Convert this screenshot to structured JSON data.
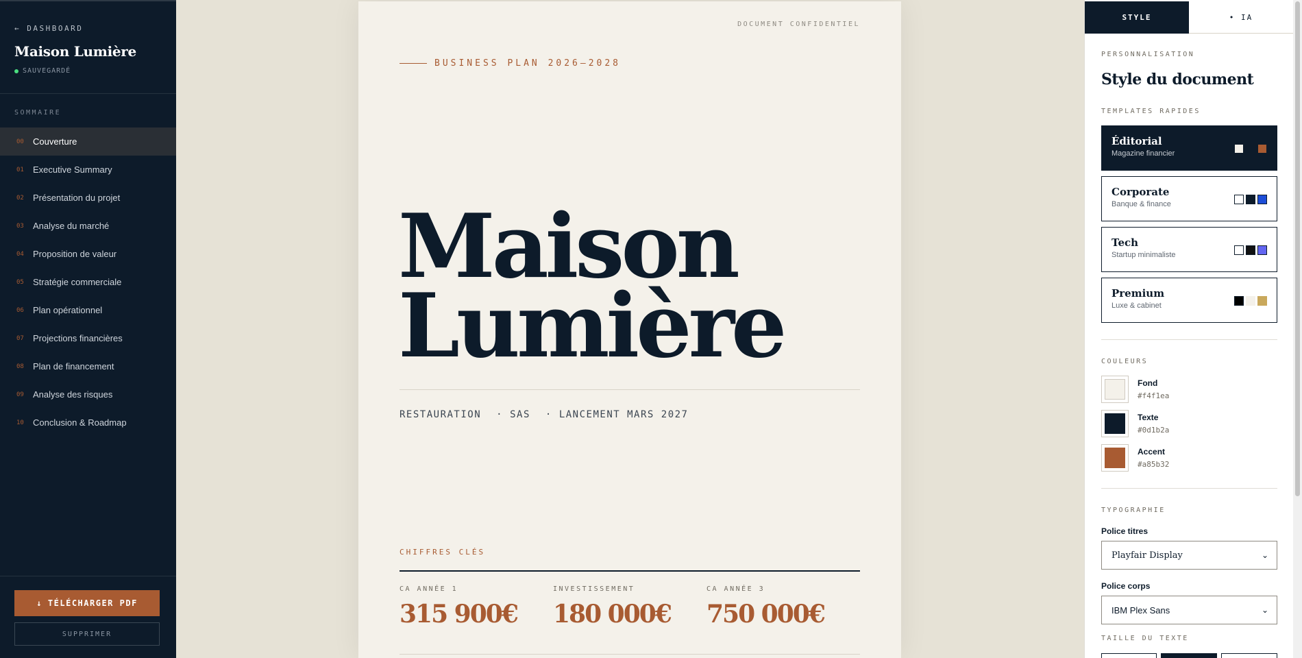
{
  "sidebar": {
    "back_label": "← DASHBOARD",
    "project_name": "Maison Lumière",
    "save_status": "SAUVEGARDÉ",
    "toc_heading": "SOMMAIRE",
    "toc": [
      {
        "num": "00",
        "label": "Couverture"
      },
      {
        "num": "01",
        "label": "Executive Summary"
      },
      {
        "num": "02",
        "label": "Présentation du projet"
      },
      {
        "num": "03",
        "label": "Analyse du marché"
      },
      {
        "num": "04",
        "label": "Proposition de valeur"
      },
      {
        "num": "05",
        "label": "Stratégie commerciale"
      },
      {
        "num": "06",
        "label": "Plan opérationnel"
      },
      {
        "num": "07",
        "label": "Projections financières"
      },
      {
        "num": "08",
        "label": "Plan de financement"
      },
      {
        "num": "09",
        "label": "Analyse des risques"
      },
      {
        "num": "10",
        "label": "Conclusion & Roadmap"
      }
    ],
    "download_label": "TÉLÉCHARGER PDF",
    "download_icon": "download-icon",
    "delete_label": "SUPPRIMER"
  },
  "document": {
    "confidential": "DOCUMENT CONFIDENTIEL",
    "eyebrow": "BUSINESS PLAN 2026–2028",
    "title_line1": "Maison",
    "title_line2": "Lumière",
    "meta": [
      "RESTAURATION",
      "SAS",
      "LANCEMENT MARS 2027"
    ],
    "key_figures_label": "CHIFFRES CLÉS",
    "key_figures": [
      {
        "caption": "CA ANNÉE 1",
        "value": "315 900€"
      },
      {
        "caption": "INVESTISSEMENT",
        "value": "180 000€"
      },
      {
        "caption": "CA ANNÉE 3",
        "value": "750 000€"
      }
    ]
  },
  "panel": {
    "tabs": {
      "style": "STYLE",
      "ia": "• IA"
    },
    "eyebrow": "PERSONNALISATION",
    "title": "Style du document",
    "templates_heading": "TEMPLATES RAPIDES",
    "templates": [
      {
        "name": "Éditorial",
        "subtitle": "Magazine financier",
        "swatches": [
          "#f4f1ea",
          "#0d1b2a",
          "#a85b32"
        ]
      },
      {
        "name": "Corporate",
        "subtitle": "Banque & finance",
        "swatches": [
          "#ffffff",
          "#0d1b2a",
          "#1d4ed8"
        ]
      },
      {
        "name": "Tech",
        "subtitle": "Startup minimaliste",
        "swatches": [
          "#ffffff",
          "#111111",
          "#6366f1"
        ]
      },
      {
        "name": "Premium",
        "subtitle": "Luxe & cabinet",
        "swatches": [
          "#000000",
          "#f4f1ea",
          "#c9a85c"
        ]
      }
    ],
    "colors_heading": "COULEURS",
    "colors": [
      {
        "name": "Fond",
        "hex": "#f4f1ea"
      },
      {
        "name": "Texte",
        "hex": "#0d1b2a"
      },
      {
        "name": "Accent",
        "hex": "#a85b32"
      }
    ],
    "typography_heading": "TYPOGRAPHIE",
    "heading_font_label": "Police titres",
    "heading_font_value": "Playfair Display",
    "body_font_label": "Police corps",
    "body_font_value": "IBM Plex Sans",
    "text_size_heading": "TAILLE DU TEXTE"
  }
}
